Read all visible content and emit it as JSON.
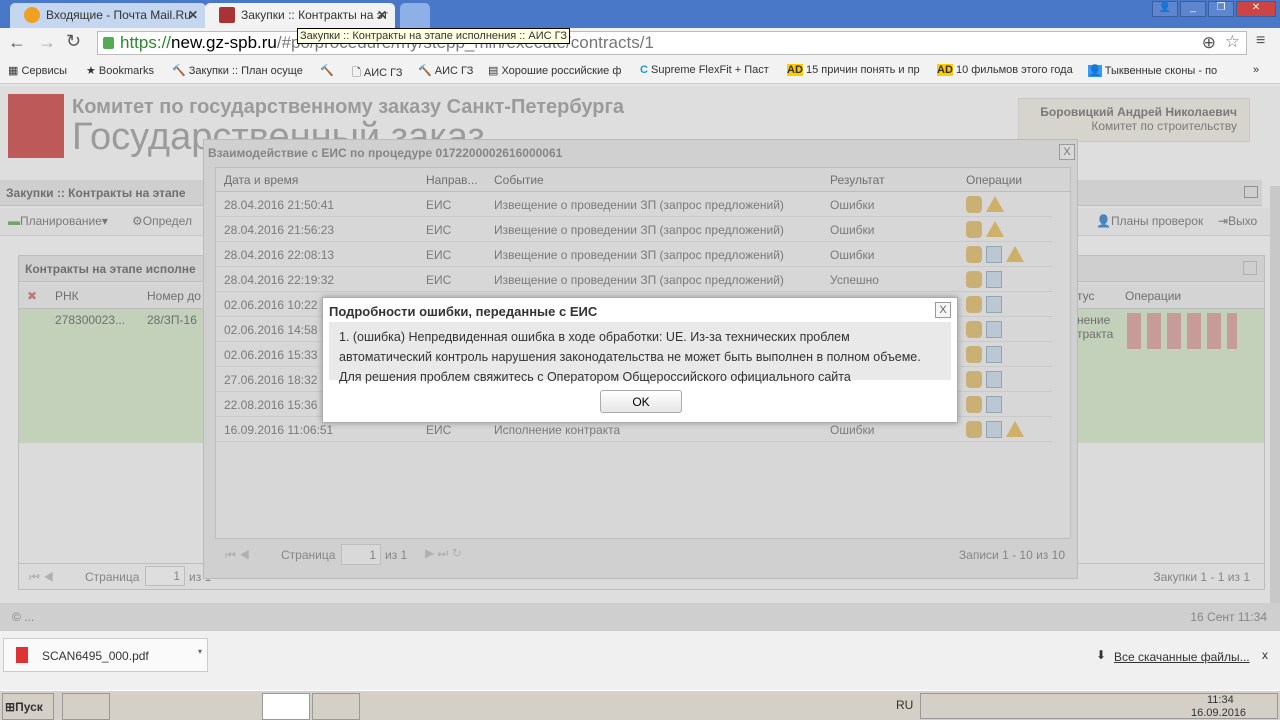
{
  "browser": {
    "tabs": [
      {
        "label": "Входящие - Почта Mail.Ru",
        "active": false
      },
      {
        "label": "Закупки :: Контракты на эт",
        "active": true
      }
    ],
    "tooltip": "Закупки :: Контракты на этапе исполнения :: АИС ГЗ",
    "url_scheme": "https://",
    "url_host": "new.gz-spb.ru",
    "url_path": "/#po/procedure/my/stepp_min/execute/contracts/1",
    "bookmarks": [
      "Сервисы",
      "Bookmarks",
      "Закупки :: План осуще",
      "",
      "АИС ГЗ",
      "АИС ГЗ",
      "Хорошие российские ф",
      "Supreme FlexFit + Паст",
      "15 причин понять и пр",
      "10 фильмов этого года",
      "Тыквенные сконы - по"
    ],
    "more": "»"
  },
  "header": {
    "org": "Комитет по государственному заказу Санкт-Петербурга",
    "system": "Государственный заказ",
    "user_name": "Боровицкий Андрей Николаевич",
    "user_dept": "Комитет по строительству"
  },
  "panel": {
    "title": "Закупки :: Контракты на этапе",
    "toolbar": [
      "Планирование",
      "Определ",
      "Планы проверок",
      "Выхо"
    ],
    "grid_title": "Контракты на этапе исполне",
    "columns": [
      "РНК",
      "Номер до",
      "тус",
      "Операции"
    ],
    "row": {
      "rnk": "278300023...",
      "num": "28/ЗП-16",
      "status": "нение\nтракта"
    },
    "pager": {
      "page_label": "Страница",
      "page": "1",
      "of": "из 1",
      "summary": "Закупки 1 - 1 из 1"
    }
  },
  "footer": {
    "copyright": "© ...",
    "datetime": "16 Сент 11:34"
  },
  "eis_dialog": {
    "title": "Взаимодействие с ЕИС по процедуре 0172200002616000061",
    "columns": [
      "Дата и время",
      "Направ...",
      "Событие",
      "Результат",
      "Операции"
    ],
    "rows": [
      {
        "date": "28.04.2016 21:50:41",
        "dir": "ЕИС",
        "event": "Извещение о проведении ЗП (запрос предложений)",
        "result": "Ошибки",
        "ops": [
          "cube",
          "warn"
        ]
      },
      {
        "date": "28.04.2016 21:56:23",
        "dir": "ЕИС",
        "event": "Извещение о проведении ЗП (запрос предложений)",
        "result": "Ошибки",
        "ops": [
          "cube",
          "warn"
        ]
      },
      {
        "date": "28.04.2016 22:08:13",
        "dir": "ЕИС",
        "event": "Извещение о проведении ЗП (запрос предложений)",
        "result": "Ошибки",
        "ops": [
          "cube",
          "doc",
          "warn"
        ]
      },
      {
        "date": "28.04.2016 22:19:32",
        "dir": "ЕИС",
        "event": "Извещение о проведении ЗП (запрос предложений)",
        "result": "Успешно",
        "ops": [
          "cube",
          "doc"
        ]
      },
      {
        "date": "02.06.2016 10:22",
        "dir": "",
        "event": "",
        "result": "",
        "ops": [
          "cube",
          "doc"
        ]
      },
      {
        "date": "02.06.2016 14:58",
        "dir": "",
        "event": "",
        "result": "",
        "ops": [
          "cube",
          "doc"
        ]
      },
      {
        "date": "02.06.2016 15:33",
        "dir": "",
        "event": "",
        "result": "",
        "ops": [
          "cube",
          "doc"
        ]
      },
      {
        "date": "27.06.2016 18:32",
        "dir": "",
        "event": "",
        "result": "",
        "ops": [
          "cube",
          "doc"
        ]
      },
      {
        "date": "22.08.2016 15:36",
        "dir": "",
        "event": "",
        "result": "",
        "ops": [
          "cube",
          "doc"
        ]
      },
      {
        "date": "16.09.2016 11:06:51",
        "dir": "ЕИС",
        "event": "Исполнение контракта",
        "result": "Ошибки",
        "ops": [
          "cube",
          "doc",
          "warn"
        ]
      }
    ],
    "pager": {
      "page_label": "Страница",
      "page": "1",
      "of": "из 1",
      "summary": "Записи 1 - 10 из 10"
    }
  },
  "error_dialog": {
    "title": "Подробности ошибки, переданные с ЕИС",
    "message": "1. (ошибка) Непредвиденная ошибка в ходе обработки: UE. Из-за технических проблем автоматический контроль нарушения законодательства не может быть выполнен в полном объеме. Для решения проблем свяжитесь с Оператором Общероссийского официального сайта",
    "ok": "OK"
  },
  "downloads": {
    "file": "SCAN6495_000.pdf",
    "all": "Все скачанные файлы...",
    "close": "x"
  },
  "taskbar": {
    "start": "Пуск",
    "lang": "RU",
    "time": "11:34",
    "date": "16.09.2016"
  }
}
